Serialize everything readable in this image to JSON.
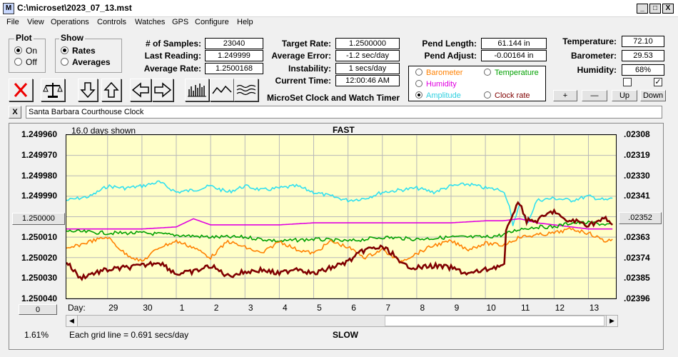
{
  "window": {
    "title": "C:\\microset\\2023_07_13.mst",
    "app_icon": "M",
    "min_glyph": "_",
    "max_glyph": "□",
    "close_glyph": "X"
  },
  "menu": [
    "File",
    "View",
    "Operations",
    "Controls",
    "Watches",
    "GPS",
    "Configure",
    "Help"
  ],
  "plot_group": {
    "title": "Plot",
    "on": "On",
    "off": "Off",
    "selected": "On"
  },
  "show_group": {
    "title": "Show",
    "rates": "Rates",
    "averages": "Averages",
    "selected": "Rates"
  },
  "stats": {
    "samples_label": "# of Samples:",
    "samples": "23040",
    "last_reading_label": "Last Reading:",
    "last_reading": "1.249999",
    "average_rate_label": "Average Rate:",
    "average_rate": "1.2500168",
    "target_rate_label": "Target Rate:",
    "target_rate": "1.2500000",
    "average_error_label": "Average Error:",
    "average_error": "-1.2 sec/day",
    "instability_label": "Instability:",
    "instability": "1 secs/day",
    "current_time_label": "Current Time:",
    "current_time": "12:00:46 AM",
    "app_name": "MicroSet Clock and Watch Timer",
    "pend_length_label": "Pend Length:",
    "pend_length": "61.144 in",
    "pend_adjust_label": "Pend Adjust:",
    "pend_adjust": "-0.00164 in"
  },
  "environment": {
    "temperature_label": "Temperature:",
    "temperature": "72.10",
    "barometer_label": "Barometer:",
    "barometer": "29.53",
    "humidity_label": "Humidity:",
    "humidity": "68%",
    "plus": "+",
    "minus": "—",
    "up": "Up",
    "down": "Down",
    "check1": "",
    "check2": "✓"
  },
  "legend": {
    "barometer": "Barometer",
    "temperature": "Temperature",
    "humidity": "Humidity",
    "amplitude": "Amplitude",
    "clock_rate": "Clock rate",
    "selected": "Amplitude"
  },
  "colors": {
    "barometer": "#ff8000",
    "temperature": "#00a000",
    "humidity": "#e000e0",
    "amplitude": "#30e0f0",
    "clock_rate": "#800000"
  },
  "toolbar_icons": [
    "delete-icon",
    "scale-icon",
    "arrow-down-icon",
    "arrow-up-icon",
    "arrow-left-icon",
    "arrow-right-icon",
    "bars-icon",
    "wave-icon",
    "waves-icon"
  ],
  "clock_name": {
    "close_glyph": "X",
    "value": "Santa Barbara Courthouse Clock"
  },
  "plot": {
    "days_shown": "16.0 days shown",
    "fast_label": "FAST",
    "slow_label": "SLOW",
    "day_label": "Day:",
    "grid_note": "Each grid line = 0.691 secs/day",
    "percent": "1.61%",
    "left_button": "1.250000",
    "right_button": ".02352",
    "zero_button": "0"
  },
  "chart_data": {
    "type": "line",
    "y_left_ticks": [
      "1.249960",
      "1.249970",
      "1.249980",
      "1.249990",
      "1.250000",
      "1.250010",
      "1.250020",
      "1.250030",
      "1.250040"
    ],
    "y_right_ticks": [
      ".02308",
      ".02319",
      ".02330",
      ".02341",
      ".02352",
      ".02363",
      ".02374",
      ".02385",
      ".02396"
    ],
    "x_ticks": [
      "29",
      "30",
      "1",
      "2",
      "3",
      "4",
      "5",
      "6",
      "7",
      "8",
      "9",
      "10",
      "11",
      "12",
      "13"
    ],
    "x_positions": [
      -1,
      0,
      1,
      2,
      3,
      4,
      5,
      6,
      7,
      8,
      9,
      10,
      11,
      12,
      13
    ],
    "xlim": [
      -2.2,
      13.8
    ],
    "ylim": [
      1.24996,
      1.25004
    ],
    "grid": true,
    "series": [
      {
        "color_key": "amplitude",
        "x": [
          -2.2,
          -1.5,
          -1,
          -0.5,
          0,
          0.5,
          1,
          1.5,
          2,
          2.5,
          3,
          3.5,
          4,
          4.5,
          5,
          5.5,
          6,
          6.5,
          7,
          7.5,
          8,
          8.5,
          9,
          9.5,
          10,
          10.5,
          10.6,
          10.7,
          10.8,
          11,
          11.2,
          11.5,
          12,
          12.5,
          13,
          13.5,
          13.7
        ],
        "y": [
          1.249992,
          1.24999,
          1.249985,
          1.249986,
          1.249985,
          1.249983,
          1.249988,
          1.249987,
          1.249985,
          1.249988,
          1.249985,
          1.249987,
          1.249986,
          1.249985,
          1.249988,
          1.24999,
          1.249992,
          1.249991,
          1.249988,
          1.249987,
          1.249986,
          1.249988,
          1.249985,
          1.249984,
          1.249986,
          1.249987,
          1.24999,
          1.249995,
          1.250005,
          1.249993,
          1.250004,
          1.249992,
          1.249991,
          1.249992,
          1.24999,
          1.249992,
          1.249991
        ]
      },
      {
        "color_key": "humidity",
        "x": [
          -2.2,
          -1,
          0,
          1,
          1.5,
          2,
          3,
          4,
          5,
          6,
          7,
          8,
          9,
          10,
          10.5,
          11,
          11.5,
          12,
          12.5,
          13,
          13.7
        ],
        "y": [
          1.250006,
          1.250006,
          1.250006,
          1.250005,
          1.250001,
          1.250004,
          1.250004,
          1.250004,
          1.250003,
          1.250003,
          1.250003,
          1.250003,
          1.250003,
          1.250002,
          1.250002,
          1.250001,
          1.250003,
          1.250004,
          1.250005,
          1.250006,
          1.250006
        ]
      },
      {
        "color_key": "temperature",
        "x": [
          -2.2,
          -1,
          0,
          1,
          2,
          3,
          4,
          5,
          6,
          7,
          8,
          9,
          10,
          10.5,
          11,
          11.5,
          12,
          12.5,
          13,
          13.7
        ],
        "y": [
          1.250007,
          1.250008,
          1.250008,
          1.250009,
          1.25001,
          1.25001,
          1.250012,
          1.250011,
          1.250012,
          1.25001,
          1.250011,
          1.25001,
          1.25001,
          1.250009,
          1.250006,
          1.250005,
          1.250005,
          1.250003,
          1.250003,
          1.250004
        ]
      },
      {
        "color_key": "barometer",
        "x": [
          -2.2,
          -1.5,
          -1,
          -0.5,
          0,
          0.5,
          1,
          1.5,
          2,
          2.5,
          3,
          3.5,
          4,
          4.5,
          5,
          5.5,
          6,
          6.5,
          7,
          7.5,
          8,
          8.5,
          9,
          9.5,
          10,
          10.5,
          11,
          11.5,
          12,
          12.5,
          13,
          13.5,
          13.7
        ],
        "y": [
          1.250016,
          1.250012,
          1.25001,
          1.250018,
          1.250022,
          1.250015,
          1.250012,
          1.250015,
          1.25002,
          1.250012,
          1.250015,
          1.250018,
          1.250012,
          1.250016,
          1.250018,
          1.250012,
          1.250015,
          1.25002,
          1.250016,
          1.250022,
          1.250018,
          1.250014,
          1.250012,
          1.250016,
          1.250013,
          1.250014,
          1.25001,
          1.250009,
          1.250008,
          1.250006,
          1.250008,
          1.250012,
          1.250011
        ]
      },
      {
        "color_key": "clock_rate",
        "x": [
          -2.2,
          -1.8,
          -1.5,
          -1,
          -0.5,
          0,
          0.5,
          1,
          1.5,
          2,
          2.5,
          3,
          3.5,
          4,
          4.5,
          5,
          5.5,
          6,
          6.5,
          7,
          7.3,
          7.5,
          8,
          8.5,
          9,
          9.5,
          10,
          10.4,
          10.55,
          10.6,
          10.8,
          11,
          11.2,
          11.5,
          12,
          12.3,
          12.6,
          13,
          13.5,
          13.7
        ],
        "y": [
          1.250022,
          1.25003,
          1.250028,
          1.250026,
          1.250025,
          1.250024,
          1.250022,
          1.250028,
          1.250027,
          1.250024,
          1.250029,
          1.250027,
          1.250026,
          1.250028,
          1.250025,
          1.250028,
          1.250025,
          1.250022,
          1.250016,
          1.250015,
          1.250018,
          1.250023,
          1.250025,
          1.250024,
          1.250025,
          1.250028,
          1.250026,
          1.250024,
          1.250024,
          1.250008,
          1.249998,
          1.249993,
          1.250002,
          1.250002,
          1.249997,
          1.250002,
          1.250002,
          1.250004,
          1.250001,
          1.250004
        ]
      }
    ]
  }
}
